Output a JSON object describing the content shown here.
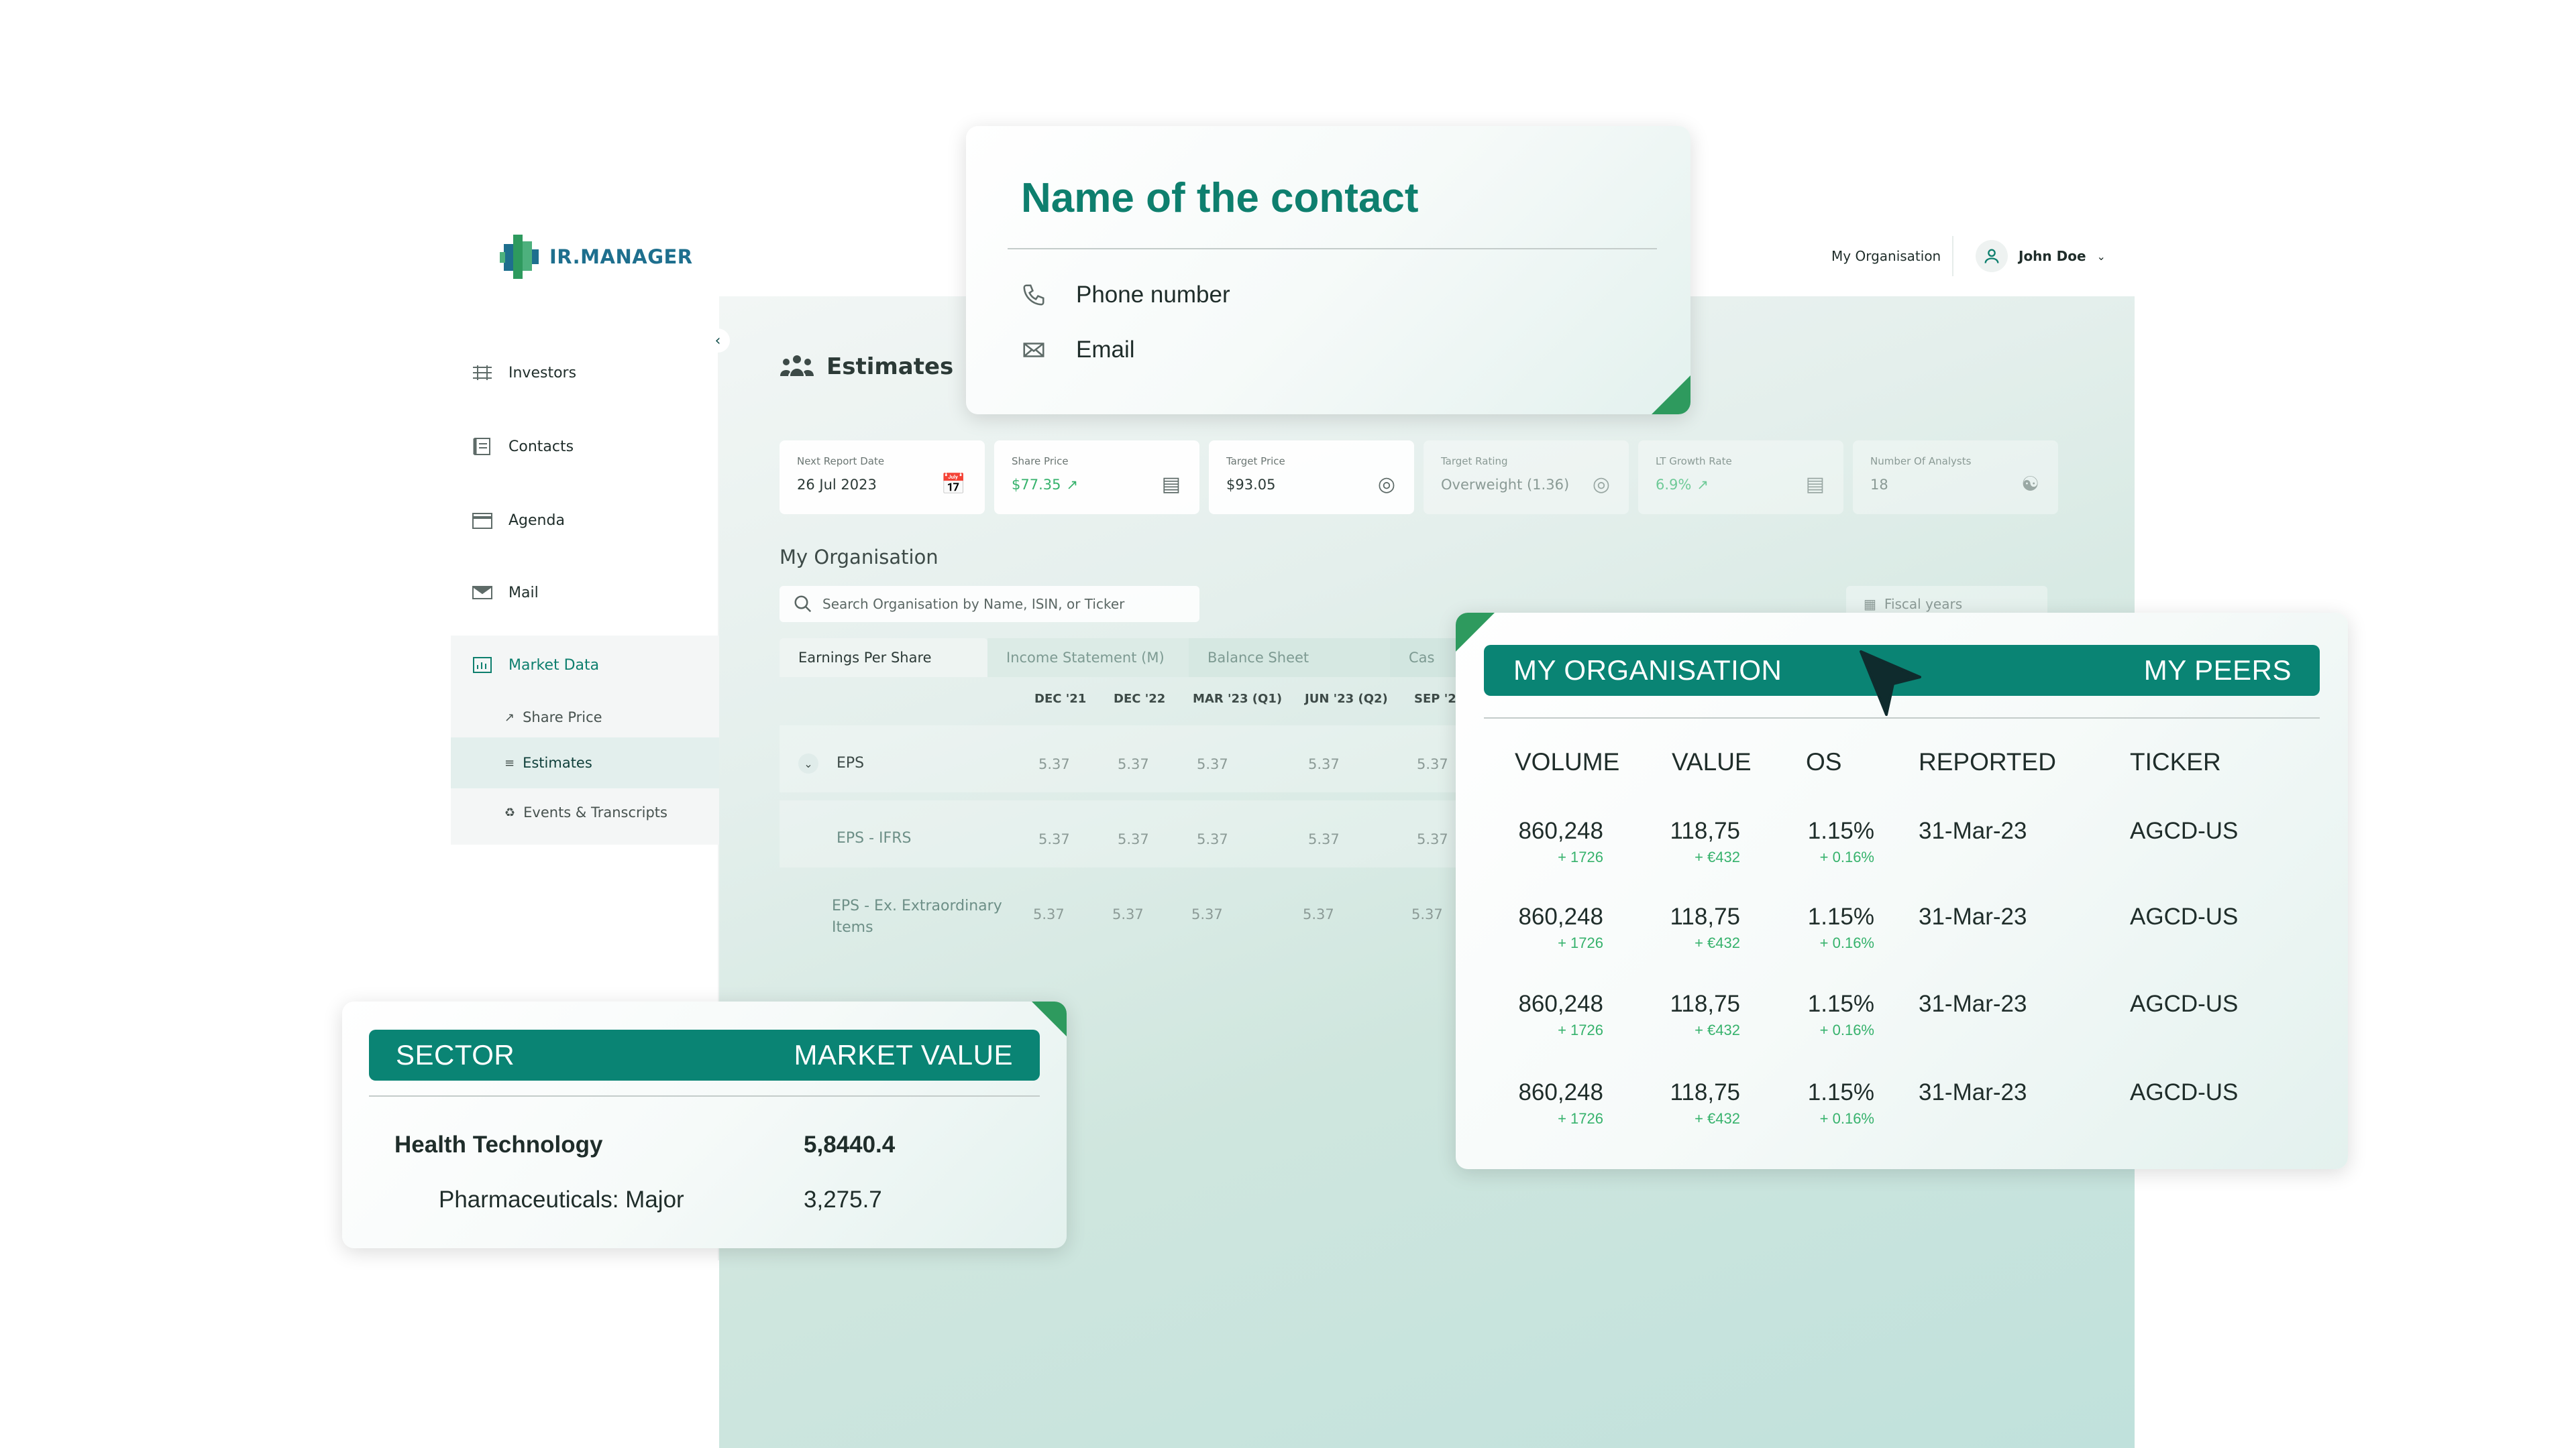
{
  "app": {
    "logo_text": "IR.MANAGER"
  },
  "topbar": {
    "organisation": "My Organisation",
    "user_name": "John Doe"
  },
  "sidebar": {
    "items": [
      {
        "label": "Investors",
        "icon": "investors-icon"
      },
      {
        "label": "Contacts",
        "icon": "contacts-icon"
      },
      {
        "label": "Agenda",
        "icon": "calendar-icon"
      },
      {
        "label": "Mail",
        "icon": "mail-icon"
      },
      {
        "label": "Market Data",
        "icon": "market-data-icon"
      }
    ],
    "sub_items": [
      {
        "label": "Share Price",
        "icon": "trend-icon"
      },
      {
        "label": "Estimates",
        "icon": "estimates-icon"
      },
      {
        "label": "Events & Transcripts",
        "icon": "events-icon"
      }
    ]
  },
  "main": {
    "title": "Estimates",
    "kpis": [
      {
        "label": "Next Report Date",
        "value": "26 Jul 2023",
        "icon": "calendar-icon"
      },
      {
        "label": "Share Price",
        "value": "$77.35",
        "icon": "bar-chart-icon"
      },
      {
        "label": "Target Price",
        "value": "$93.05",
        "icon": "target-icon"
      },
      {
        "label": "Target Rating",
        "value": "Overweight (1.36)",
        "icon": "target-icon"
      },
      {
        "label": "LT Growth Rate",
        "value": "6.9%",
        "icon": "chart-icon"
      },
      {
        "label": "Number Of Analysts",
        "value": "18",
        "icon": "people-icon"
      }
    ],
    "section_title": "My Organisation",
    "search_placeholder": "Search Organisation by Name, ISIN, or Ticker",
    "fiscal_label": "Fiscal years",
    "tabs": [
      "Earnings Per Share",
      "Income Statement (M)",
      "Balance Sheet",
      "Cas"
    ],
    "columns": [
      "DEC '21",
      "DEC '22",
      "MAR '23 (Q1)",
      "JUN '23 (Q2)",
      "SEP '2"
    ],
    "rows": [
      {
        "label": "EPS",
        "values": [
          "5.37",
          "5.37",
          "5.37",
          "5.37",
          "5.37"
        ]
      },
      {
        "label": "EPS - IFRS",
        "values": [
          "5.37",
          "5.37",
          "5.37",
          "5.37",
          "5.37"
        ]
      },
      {
        "label": "EPS - Ex. Extraordinary Items",
        "values": [
          "5.37",
          "5.37",
          "5.37",
          "5.37",
          "5.37"
        ]
      }
    ]
  },
  "contact_card": {
    "title": "Name of the contact",
    "phone": "Phone number",
    "email": "Email"
  },
  "sector_card": {
    "headers": [
      "SECTOR",
      "MARKET VALUE"
    ],
    "rows": [
      {
        "sector": "Health Technology",
        "value": "5,8440.4"
      },
      {
        "sector": "Pharmaceuticals: Major",
        "value": "3,275.7"
      }
    ]
  },
  "peers_card": {
    "tabs": [
      "MY ORGANISATION",
      "MY PEERS"
    ],
    "headers": [
      "VOLUME",
      "VALUE",
      "OS",
      "REPORTED",
      "TICKER"
    ],
    "rows": [
      {
        "volume": "860,248",
        "volume_delta": "+ 1726",
        "value": "118,75",
        "value_delta": "+ €432",
        "os": "1.15%",
        "os_delta": "+ 0.16%",
        "reported": "31-Mar-23",
        "ticker": "AGCD-US"
      },
      {
        "volume": "860,248",
        "volume_delta": "+ 1726",
        "value": "118,75",
        "value_delta": "+ €432",
        "os": "1.15%",
        "os_delta": "+ 0.16%",
        "reported": "31-Mar-23",
        "ticker": "AGCD-US"
      },
      {
        "volume": "860,248",
        "volume_delta": "+ 1726",
        "value": "118,75",
        "value_delta": "+ €432",
        "os": "1.15%",
        "os_delta": "+ 0.16%",
        "reported": "31-Mar-23",
        "ticker": "AGCD-US"
      },
      {
        "volume": "860,248",
        "volume_delta": "+ 1726",
        "value": "118,75",
        "value_delta": "+ €432",
        "os": "1.15%",
        "os_delta": "+ 0.16%",
        "reported": "31-Mar-23",
        "ticker": "AGCD-US"
      }
    ]
  },
  "colors": {
    "brand_green": "#0a8474",
    "accent_green": "#2e9a5e",
    "positive": "#36b26c",
    "logo_blue": "#1e6f8e"
  }
}
